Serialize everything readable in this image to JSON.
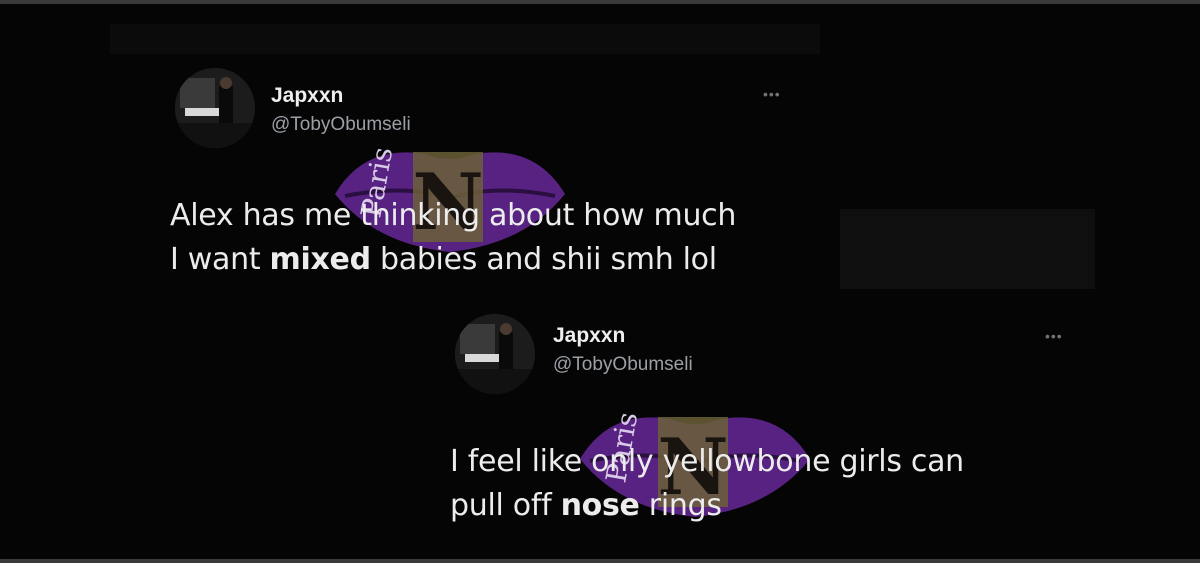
{
  "tweets": [
    {
      "display_name": "Japxxn",
      "handle": "@TobyObumseli",
      "more_icon": "more-horizontal-icon",
      "text_lines": [
        {
          "before": "Alex has me thinking about how much",
          "bold": "",
          "after": ""
        },
        {
          "before": "I want ",
          "bold": "mixed",
          "after": " babies and shii smh lol"
        }
      ]
    },
    {
      "display_name": "Japxxn",
      "handle": "@TobyObumseli",
      "more_icon": "more-horizontal-icon",
      "text_lines": [
        {
          "before": "I feel like only yellowbone girls can",
          "bold": "",
          "after": ""
        },
        {
          "before": "pull off ",
          "bold": "nose",
          "after": " rings"
        }
      ]
    }
  ],
  "watermark": {
    "icon": "purple-lips-logo-icon",
    "colors": {
      "lips": "#6a2a9a",
      "letter": "#8a7a40"
    }
  }
}
